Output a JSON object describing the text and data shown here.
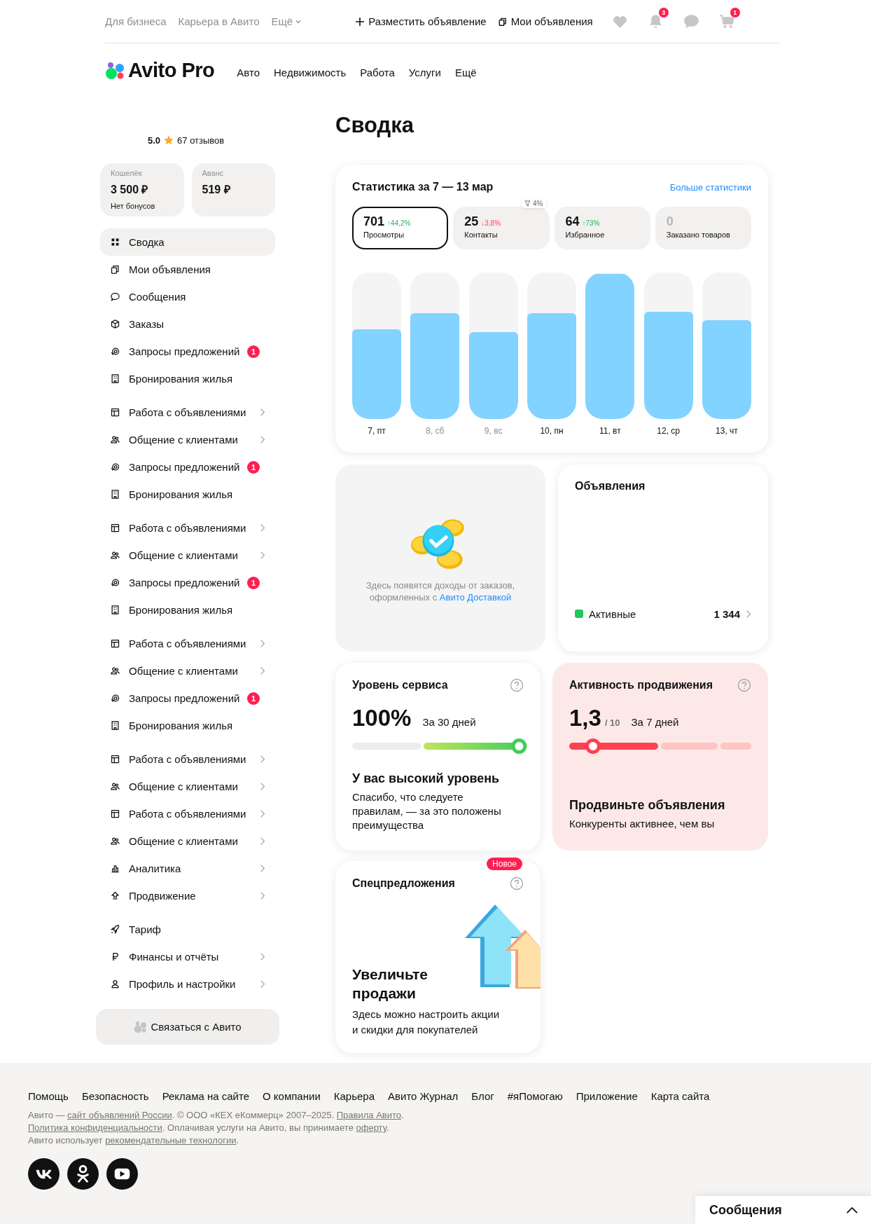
{
  "top_bar": {
    "links": [
      {
        "label": "Для бизнеса"
      },
      {
        "label": "Карьера в Авито"
      }
    ],
    "more": "Ещё",
    "post_ad": "Разместить объявление",
    "my_ads": "Мои объявления",
    "notifications_badge": "3",
    "cart_badge": "1"
  },
  "header": {
    "logo": "Avito Pro",
    "nav": [
      {
        "label": "Авто"
      },
      {
        "label": "Недвижимость"
      },
      {
        "label": "Работа"
      },
      {
        "label": "Услуги"
      },
      {
        "label": "Ещё"
      }
    ]
  },
  "profile": {
    "rating": "5.0",
    "reviews": "67 отзывов"
  },
  "wallets": [
    {
      "label": "Кошелёк",
      "amount": "3 500 ₽",
      "note": "Нет бонусов"
    },
    {
      "label": "Аванс",
      "amount": "519 ₽"
    }
  ],
  "sidebar": {
    "groups": [
      {
        "items": [
          {
            "label": "Сводка",
            "selected": true,
            "expandable": false
          },
          {
            "label": "Мои объявления",
            "selected": false,
            "expandable": false
          },
          {
            "label": "Сообщения",
            "selected": false,
            "expandable": false
          },
          {
            "label": "Заказы",
            "selected": false,
            "expandable": false
          },
          {
            "label": "Запросы предложений",
            "selected": false,
            "expandable": false,
            "badge": "1"
          },
          {
            "label": "Бронирования жилья",
            "selected": false,
            "expandable": false
          }
        ]
      },
      {
        "items": [
          {
            "label": "Работа с объявлениями",
            "selected": false,
            "expandable": true
          },
          {
            "label": "Общение с клиентами",
            "selected": false,
            "expandable": true
          },
          {
            "label": "Запросы предложений",
            "selected": false,
            "expandable": false,
            "badge": "1"
          },
          {
            "label": "Бронирования жилья",
            "selected": false,
            "expandable": false
          }
        ]
      },
      {
        "items": [
          {
            "label": "Работа с объявлениями",
            "selected": false,
            "expandable": true
          },
          {
            "label": "Общение с клиентами",
            "selected": false,
            "expandable": true
          },
          {
            "label": "Запросы предложений",
            "selected": false,
            "expandable": false,
            "badge": "1"
          },
          {
            "label": "Бронирования жилья",
            "selected": false,
            "expandable": false
          }
        ]
      },
      {
        "items": [
          {
            "label": "Работа с объявлениями",
            "selected": false,
            "expandable": true
          },
          {
            "label": "Общение с клиентами",
            "selected": false,
            "expandable": true
          },
          {
            "label": "Запросы предложений",
            "selected": false,
            "expandable": false,
            "badge": "1"
          },
          {
            "label": "Бронирования жилья",
            "selected": false,
            "expandable": false
          }
        ]
      },
      {
        "items": [
          {
            "label": "Работа с объявлениями",
            "selected": false,
            "expandable": true
          },
          {
            "label": "Общение с клиентами",
            "selected": false,
            "expandable": true
          },
          {
            "label": "Работа с объявлениями",
            "selected": false,
            "expandable": true
          },
          {
            "label": "Общение с клиентами",
            "selected": false,
            "expandable": true
          },
          {
            "label": "Аналитика",
            "selected": false,
            "expandable": true
          },
          {
            "label": "Продвижение",
            "selected": false,
            "expandable": true
          }
        ]
      },
      {
        "items": [
          {
            "label": "Тариф",
            "selected": false,
            "expandable": false
          },
          {
            "label": "Финансы и отчёты",
            "selected": false,
            "expandable": true
          },
          {
            "label": "Профиль и настройки",
            "selected": false,
            "expandable": true
          }
        ]
      }
    ],
    "contact_button": "Связаться с Авито"
  },
  "page_title": "Сводка",
  "stats": {
    "title": "Статистика за 7 — 13 мар",
    "more_link": "Больше статистики",
    "metrics": [
      {
        "value": "701",
        "change": "↑44,2%",
        "positive": true,
        "label": "Просмотры",
        "selected": true,
        "disabled": false
      },
      {
        "value": "25",
        "change": "↓3,8%",
        "positive": false,
        "label": "Контакты",
        "selected": false,
        "disabled": false,
        "hint": "4%"
      },
      {
        "value": "64",
        "change": "↑73%",
        "positive": true,
        "label": "Избранное",
        "selected": false,
        "disabled": false
      },
      {
        "value": "0",
        "label": "Заказано товаров",
        "selected": false,
        "disabled": true
      }
    ],
    "days": [
      {
        "label": "7, пт",
        "level": 0.62,
        "weekend": false
      },
      {
        "label": "8, сб",
        "level": 0.73,
        "weekend": true
      },
      {
        "label": "9, вс",
        "level": 0.6,
        "weekend": true
      },
      {
        "label": "10, пн",
        "level": 0.73,
        "weekend": false
      },
      {
        "label": "11, вт",
        "level": 1,
        "weekend": false
      },
      {
        "label": "12, ср",
        "level": 0.74,
        "weekend": false
      },
      {
        "label": "13, чт",
        "level": 0.68,
        "weekend": false
      }
    ]
  },
  "income": {
    "text": "Здесь появятся доходы от заказов, оформленных с",
    "link": "Авито Доставкой"
  },
  "ads": {
    "title": "Объявления",
    "rows": [
      {
        "label": "Активные",
        "count": "1 344",
        "color": "#1ec85a"
      }
    ]
  },
  "service": {
    "title": "Уровень сервиса",
    "value": "100%",
    "period": "За 30 дней",
    "level": 1,
    "heading": "У вас высокий уровень",
    "text": "Спасибо, что следуете правилам, — за это положены преимущества"
  },
  "promotion": {
    "title": "Активность продвижения",
    "value": "1,3",
    "scale": "/ 10",
    "period": "За 7 дней",
    "level": 0.13,
    "heading": "Продвиньте объявления",
    "text": "Конкуренты активнее, чем вы"
  },
  "offers": {
    "badge": "Новое",
    "title": "Спецпредложения",
    "heading": "Увеличьте продажи",
    "text": "Здесь можно настроить акции и скидки для покупателей"
  },
  "footer": {
    "links": [
      {
        "label": "Помощь"
      },
      {
        "label": "Безопасность"
      },
      {
        "label": "Реклама на сайте"
      },
      {
        "label": "О компании"
      },
      {
        "label": "Карьера"
      },
      {
        "label": "Авито Журнал"
      },
      {
        "label": "Блог"
      },
      {
        "label": "#яПомогаю"
      },
      {
        "label": "Приложение"
      },
      {
        "label": "Карта сайта"
      }
    ],
    "legal": [
      [
        {
          "text": "Авито — ",
          "link": false
        },
        {
          "text": "сайт объявлений России",
          "link": true
        },
        {
          "text": ". © ООО «КЕХ еКоммерц» 2007–2025. ",
          "link": false
        },
        {
          "text": "Правила Авито",
          "link": true
        },
        {
          "text": ".",
          "link": false
        }
      ],
      [
        {
          "text": "Политика конфиденциальности",
          "link": true
        },
        {
          "text": ". Оплачивая услуги на Авито, вы принимаете ",
          "link": false
        },
        {
          "text": "оферту",
          "link": true
        },
        {
          "text": ".",
          "link": false
        }
      ],
      [
        {
          "text": "Авито использует ",
          "link": false
        },
        {
          "text": "рекомендательные технологии",
          "link": true
        },
        {
          "text": ".",
          "link": false
        }
      ]
    ]
  },
  "messages_widget": {
    "title": "Сообщения"
  }
}
